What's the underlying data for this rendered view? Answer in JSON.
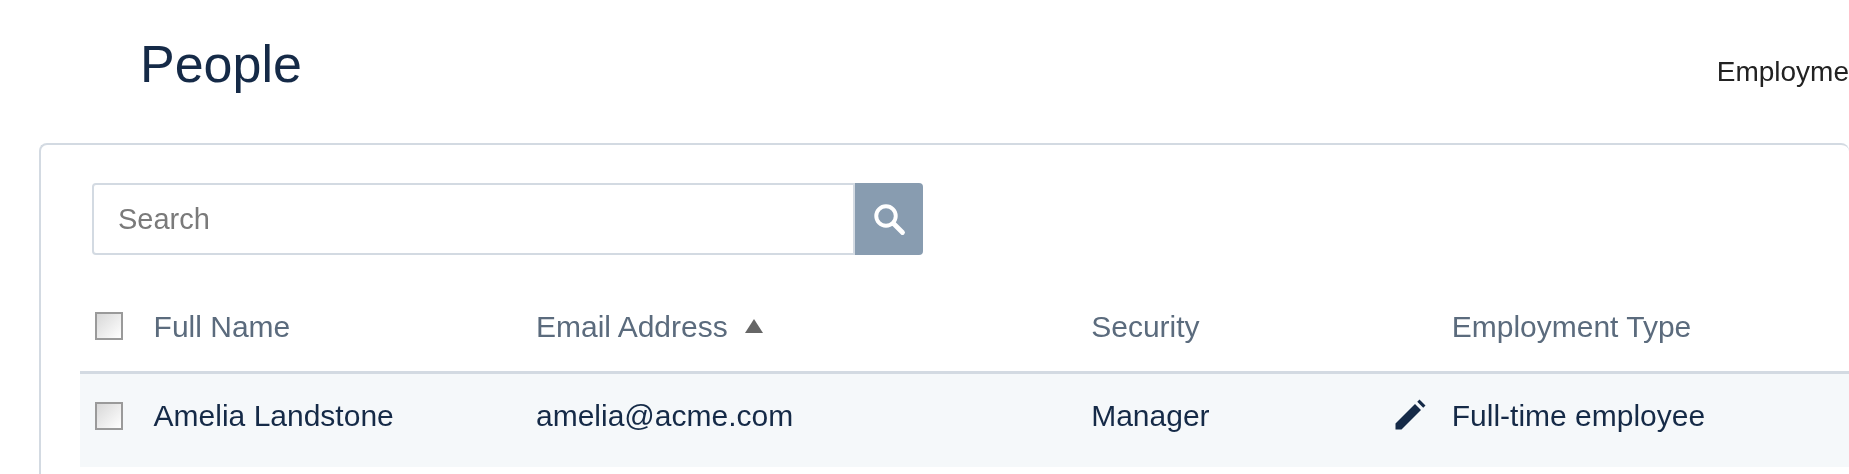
{
  "page_title": "People",
  "header_link": "Employme",
  "search": {
    "placeholder": "Search"
  },
  "table": {
    "select_all": {
      "checked": false
    },
    "columns": [
      {
        "label": "Full Name",
        "sorted": false
      },
      {
        "label": "Email Address",
        "sorted": true
      },
      {
        "label": "Security",
        "sorted": false
      },
      {
        "label": "Employment Type",
        "sorted": false
      }
    ],
    "rows": [
      {
        "checked": false,
        "cells": [
          "Amelia Landstone",
          "amelia@acme.com",
          "Manager",
          "Full-time employee"
        ],
        "editable_security": true
      }
    ]
  }
}
